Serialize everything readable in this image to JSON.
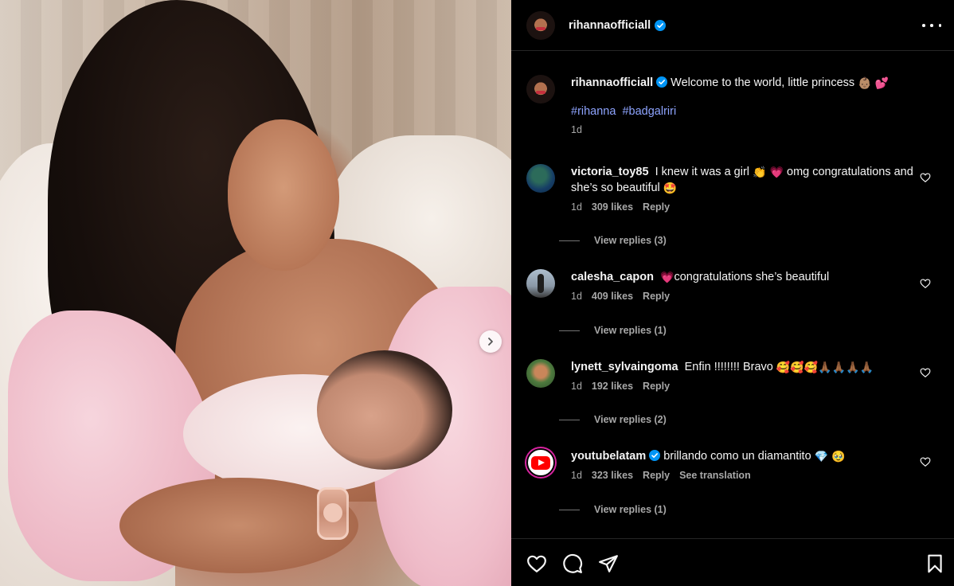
{
  "post": {
    "author": "rihannaofficiall",
    "author_verified": true,
    "more_icon": "more-horizontal-icon"
  },
  "caption": {
    "username": "rihannaofficiall",
    "text": "Welcome to the world, little princess",
    "emojis": [
      "👶🏽",
      "💕"
    ],
    "hashtags": [
      "#rihanna",
      "#badgalriri"
    ],
    "time": "1d"
  },
  "comments": [
    {
      "username": "victoria_toy85",
      "verified": false,
      "text_parts": [
        "I knew it was a girl",
        "👏",
        "💗",
        "omg congratulations and she’s so beautiful",
        "🤩"
      ],
      "time": "1d",
      "likes": "309 likes",
      "reply_label": "Reply",
      "view_replies": "View replies (3)"
    },
    {
      "username": "calesha_capon",
      "verified": false,
      "text_parts": [
        "💗",
        "congratulations she’s beautiful"
      ],
      "time": "1d",
      "likes": "409 likes",
      "reply_label": "Reply",
      "view_replies": "View replies (1)"
    },
    {
      "username": "lynett_sylvaingoma",
      "verified": false,
      "text_parts": [
        "Enfin !!!!!!!! Bravo",
        "🥰🥰🥰🙏🏾🙏🏾🙏🏾🙏🏾"
      ],
      "time": "1d",
      "likes": "192 likes",
      "reply_label": "Reply",
      "view_replies": "View replies (2)"
    },
    {
      "username": "youtubelatam",
      "verified": true,
      "text_parts": [
        "brillando como un diamantito",
        "💎",
        "🥹"
      ],
      "time": "1d",
      "likes": "323 likes",
      "reply_label": "Reply",
      "translation_label": "See translation",
      "view_replies": "View replies (1)"
    }
  ],
  "actions": {
    "like_icon": "heart-icon",
    "comment_icon": "comment-icon",
    "share_icon": "share-icon",
    "save_icon": "bookmark-icon"
  },
  "colors": {
    "background": "#000000",
    "text": "#f5f5f5",
    "muted": "#a8a8a8",
    "hashtag": "#8ea4ff",
    "verified": "#0095f6"
  }
}
